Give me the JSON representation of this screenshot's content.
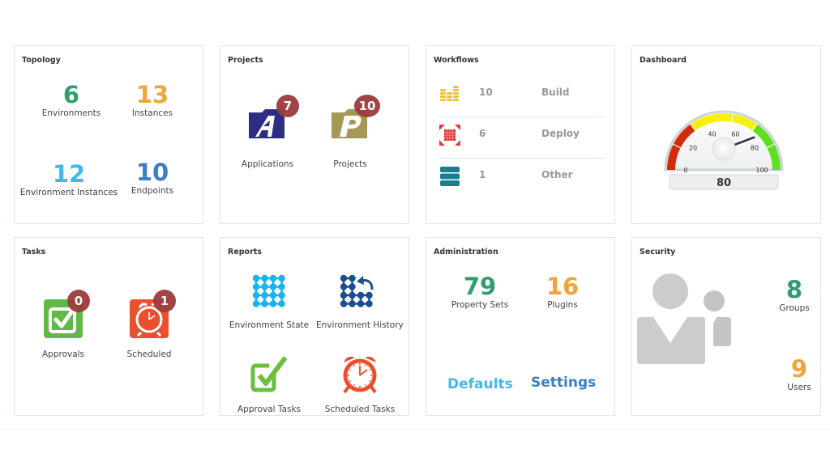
{
  "panels": {
    "topology": {
      "title": "Topology",
      "stats": [
        {
          "value": "6",
          "label": "Environments",
          "color": "#2f9e6e"
        },
        {
          "value": "13",
          "label": "Instances",
          "color": "#f0a43a"
        },
        {
          "value": "12",
          "label": "Environment Instances",
          "color": "#41b9ec"
        },
        {
          "value": "10",
          "label": "Endpoints",
          "color": "#3a7ec6"
        }
      ]
    },
    "projects": {
      "title": "Projects",
      "items": [
        {
          "label": "Applications",
          "badge": "7",
          "icon": "applications-icon",
          "color": "#2e2d86"
        },
        {
          "label": "Projects",
          "badge": "10",
          "icon": "projects-icon",
          "color": "#a59a55"
        }
      ]
    },
    "workflows": {
      "title": "Workflows",
      "rows": [
        {
          "count": "10",
          "name": "Build",
          "icon": "build-icon",
          "color": "#f5c233"
        },
        {
          "count": "6",
          "name": "Deploy",
          "icon": "deploy-icon",
          "color": "#e03a3a"
        },
        {
          "count": "1",
          "name": "Other",
          "icon": "other-icon",
          "color": "#177f8e"
        }
      ]
    },
    "dashboard": {
      "title": "Dashboard",
      "gauge": {
        "value": 80,
        "display": "80",
        "min": 0,
        "max": 100,
        "ticks": [
          "0",
          "20",
          "40",
          "60",
          "80",
          "100"
        ],
        "bands": [
          {
            "from": 0,
            "to": 30,
            "color": "#d42a0c"
          },
          {
            "from": 30,
            "to": 70,
            "color": "#f5ef12"
          },
          {
            "from": 70,
            "to": 100,
            "color": "#5ee01e"
          }
        ]
      }
    },
    "tasks": {
      "title": "Tasks",
      "items": [
        {
          "label": "Approvals",
          "badge": "0",
          "icon": "approvals-icon",
          "color": "#5fb946"
        },
        {
          "label": "Scheduled",
          "badge": "1",
          "icon": "scheduled-icon",
          "color": "#e8502e"
        }
      ]
    },
    "reports": {
      "title": "Reports",
      "items": [
        {
          "label": "Environment State",
          "icon": "environment-state-icon",
          "color": "#18b3ee"
        },
        {
          "label": "Environment History",
          "icon": "environment-history-icon",
          "color": "#1b4f8a"
        },
        {
          "label": "Approval Tasks",
          "icon": "approval-tasks-icon",
          "color": "#6bbf3f"
        },
        {
          "label": "Scheduled Tasks",
          "icon": "scheduled-tasks-icon",
          "color": "#e8502e"
        }
      ]
    },
    "administration": {
      "title": "Administration",
      "stats": [
        {
          "value": "79",
          "label": "Property Sets",
          "color": "#2f9e6e"
        },
        {
          "value": "16",
          "label": "Plugins",
          "color": "#f0a43a"
        }
      ],
      "links": [
        {
          "label": "Defaults",
          "color": "#41b9ec"
        },
        {
          "label": "Settings",
          "color": "#3a7ec6"
        }
      ]
    },
    "security": {
      "title": "Security",
      "stats": [
        {
          "value": "8",
          "label": "Groups",
          "color": "#2f9e6e"
        },
        {
          "value": "9",
          "label": "Users",
          "color": "#f0a43a"
        }
      ]
    }
  }
}
